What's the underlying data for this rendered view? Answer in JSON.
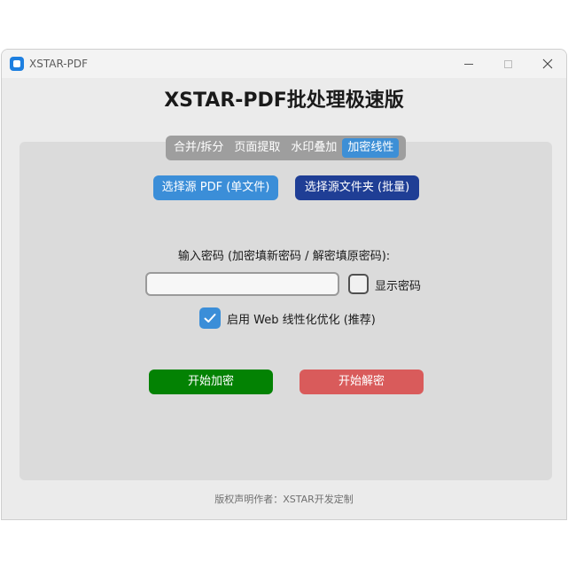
{
  "window": {
    "title": "XSTAR-PDF"
  },
  "main_title": "XSTAR-PDF批处理极速版",
  "tabs": [
    {
      "label": "合并/拆分",
      "active": false
    },
    {
      "label": "页面提取",
      "active": false
    },
    {
      "label": "水印叠加",
      "active": false
    },
    {
      "label": "加密线性",
      "active": true
    }
  ],
  "source_buttons": {
    "file_label": "选择源 PDF (单文件)",
    "folder_label": "选择源文件夹 (批量)"
  },
  "password": {
    "label": "输入密码 (加密填新密码 / 解密填原密码):",
    "value": "",
    "placeholder": "",
    "show_password_label": "显示密码",
    "show_password_checked": false
  },
  "web_optimize": {
    "label": "启用 Web 线性化优化 (推荐)",
    "checked": true
  },
  "actions": {
    "encrypt_label": "开始加密",
    "decrypt_label": "开始解密"
  },
  "footer": "版权声明作者：XSTAR开发定制",
  "colors": {
    "accent": "#3b8ed8",
    "folder_button": "#1f3e95",
    "encrypt_button": "#038203",
    "decrypt_button": "#d95b5b",
    "tab_bar": "#9e9e9e"
  },
  "icons": {
    "app": "app-icon",
    "minimize": "minimize-icon",
    "maximize": "maximize-icon",
    "close": "close-icon",
    "checkmark": "checkmark-icon"
  }
}
